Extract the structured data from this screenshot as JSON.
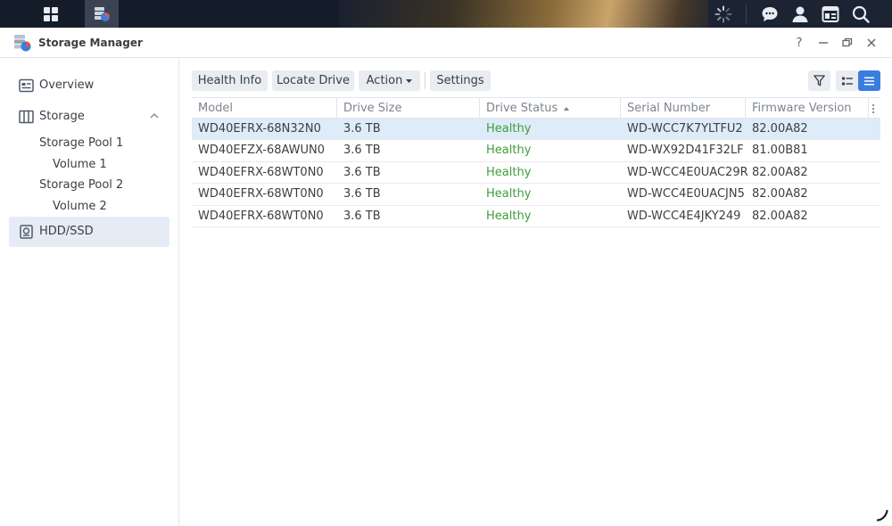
{
  "taskbar": {
    "icons": [
      "apps-grid-icon",
      "storage-manager-icon",
      "loading-spinner-icon",
      "chat-icon",
      "user-icon",
      "widgets-icon",
      "search-icon"
    ]
  },
  "window": {
    "title": "Storage Manager",
    "controls": {
      "help": "?"
    }
  },
  "sidebar": {
    "overview": "Overview",
    "storage": "Storage",
    "pool1": "Storage Pool 1",
    "volume1": "Volume 1",
    "pool2": "Storage Pool 2",
    "volume2": "Volume 2",
    "hdd": "HDD/SSD"
  },
  "toolbar": {
    "health_info": "Health Info",
    "locate_drive": "Locate Drive",
    "action": "Action",
    "settings": "Settings"
  },
  "table": {
    "columns": [
      "Model",
      "Drive Size",
      "Drive Status",
      "Serial Number",
      "Firmware Version"
    ],
    "sort_column": "Drive Status",
    "rows": [
      {
        "model": "WD40EFRX-68N32N0",
        "size": "3.6 TB",
        "status": "Healthy",
        "serial": "WD-WCC7K7YLTFU2",
        "firmware": "82.00A82",
        "selected": true
      },
      {
        "model": "WD40EFZX-68AWUN0",
        "size": "3.6 TB",
        "status": "Healthy",
        "serial": "WD-WX92D41F32LF",
        "firmware": "81.00B81",
        "selected": false
      },
      {
        "model": "WD40EFRX-68WT0N0",
        "size": "3.6 TB",
        "status": "Healthy",
        "serial": "WD-WCC4E0UAC29R",
        "firmware": "82.00A82",
        "selected": false
      },
      {
        "model": "WD40EFRX-68WT0N0",
        "size": "3.6 TB",
        "status": "Healthy",
        "serial": "WD-WCC4E0UACJN5",
        "firmware": "82.00A82",
        "selected": false
      },
      {
        "model": "WD40EFRX-68WT0N0",
        "size": "3.6 TB",
        "status": "Healthy",
        "serial": "WD-WCC4E4JKY249",
        "firmware": "82.00A82",
        "selected": false
      }
    ]
  },
  "colors": {
    "accent": "#3b7ddd",
    "healthy": "#3e9e3a",
    "selected_row": "#deebf8",
    "sidebar_active": "#e6ecf5"
  }
}
